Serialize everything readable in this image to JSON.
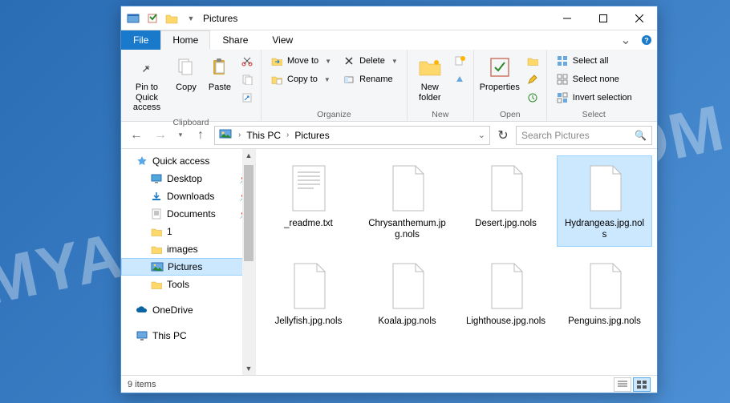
{
  "watermark": "MYANTISPYWARE.COM",
  "window": {
    "title": "Pictures"
  },
  "tabs": {
    "file": "File",
    "items": [
      "Home",
      "Share",
      "View"
    ],
    "active": "Home"
  },
  "ribbon": {
    "clipboard": {
      "label": "Clipboard",
      "pin": "Pin to Quick access",
      "copy": "Copy",
      "paste": "Paste"
    },
    "organize": {
      "label": "Organize",
      "move_to": "Move to",
      "copy_to": "Copy to",
      "delete": "Delete",
      "rename": "Rename"
    },
    "new": {
      "label": "New",
      "new_folder": "New folder"
    },
    "open": {
      "label": "Open",
      "properties": "Properties"
    },
    "select": {
      "label": "Select",
      "select_all": "Select all",
      "select_none": "Select none",
      "invert": "Invert selection"
    }
  },
  "breadcrumb": {
    "segments": [
      "This PC",
      "Pictures"
    ]
  },
  "search": {
    "placeholder": "Search Pictures"
  },
  "sidebar": {
    "quick_access": "Quick access",
    "items": [
      {
        "label": "Desktop",
        "pinned": true
      },
      {
        "label": "Downloads",
        "pinned": true
      },
      {
        "label": "Documents",
        "pinned": true
      },
      {
        "label": "1",
        "pinned": false
      },
      {
        "label": "images",
        "pinned": false
      },
      {
        "label": "Pictures",
        "pinned": false,
        "selected": true
      },
      {
        "label": "Tools",
        "pinned": false
      }
    ],
    "onedrive": "OneDrive",
    "this_pc": "This PC"
  },
  "files": [
    {
      "name": "_readme.txt",
      "type": "text"
    },
    {
      "name": "Chrysanthemum.jpg.nols",
      "type": "blank"
    },
    {
      "name": "Desert.jpg.nols",
      "type": "blank"
    },
    {
      "name": "Hydrangeas.jpg.nols",
      "type": "blank",
      "selected": true
    },
    {
      "name": "Jellyfish.jpg.nols",
      "type": "blank"
    },
    {
      "name": "Koala.jpg.nols",
      "type": "blank"
    },
    {
      "name": "Lighthouse.jpg.nols",
      "type": "blank"
    },
    {
      "name": "Penguins.jpg.nols",
      "type": "blank"
    }
  ],
  "status": {
    "count": "9 items"
  }
}
